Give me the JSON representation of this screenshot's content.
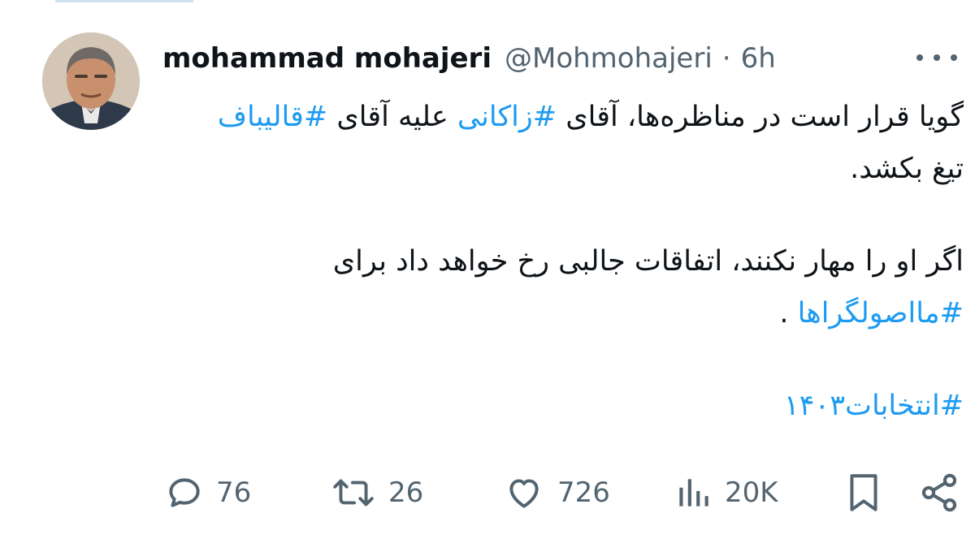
{
  "author": {
    "display_name": "mohammad mohajeri",
    "handle": "@Mohmohajeri",
    "separator": "·",
    "time": "6h"
  },
  "tweet": {
    "l1_a": "گویا قرار است در مناظره‌ها، آقای ",
    "l1_tag1": "#زاکانی",
    "l1_b": " علیه آقای ",
    "l1_tag2": "#قالیباف",
    "l2": "تیغ بکشد.",
    "l3": "اگر او را مهار نکنند، اتفاقات جالبی رخ خواهد داد برای",
    "l4_tag": "#مااصولگراها",
    "l4_b": " .",
    "l5_tag": "#انتخابات۱۴۰۳"
  },
  "actions": {
    "replies": "76",
    "retweets": "26",
    "likes": "726",
    "views": "20K"
  },
  "icons": [
    "reply-icon",
    "retweet-icon",
    "like-icon",
    "views-icon",
    "bookmark-icon",
    "share-icon",
    "more-icon"
  ],
  "colors": {
    "hashtag": "#1d9bf0",
    "meta": "#536471",
    "text": "#0f1419"
  }
}
